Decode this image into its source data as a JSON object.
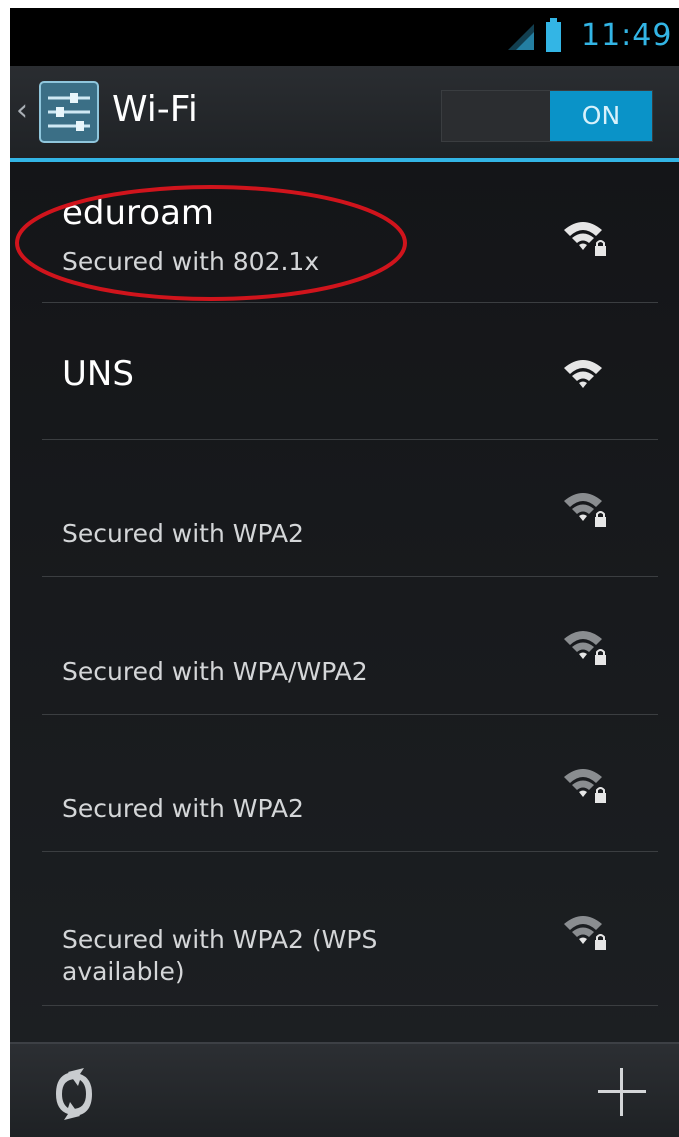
{
  "status_bar": {
    "time": "11:49",
    "icons": [
      "signal-icon",
      "battery-icon"
    ]
  },
  "action_bar": {
    "title": "Wi-Fi",
    "app_icon": "settings-sliders-icon",
    "toggle_label": "ON"
  },
  "networks": [
    {
      "ssid": "eduroam",
      "summary": "Secured with 802.1x",
      "secured": true,
      "circled": true
    },
    {
      "ssid": "UNS",
      "summary": "",
      "secured": false
    },
    {
      "ssid": "",
      "summary": "Secured with WPA2",
      "secured": true
    },
    {
      "ssid": "",
      "summary": "Secured with WPA/WPA2",
      "secured": true
    },
    {
      "ssid": "",
      "summary": "Secured with WPA2",
      "secured": true
    },
    {
      "ssid": "",
      "summary": "Secured with WPA2 (WPS available)",
      "secured": true
    }
  ],
  "bottom_bar": {
    "scan_icon": "scan-icon",
    "add_icon": "add-network-icon"
  },
  "colors": {
    "accent": "#33b5e5",
    "toggle_on": "#0a93c8",
    "circle_annotation": "#d0141c",
    "background": "#000000"
  }
}
